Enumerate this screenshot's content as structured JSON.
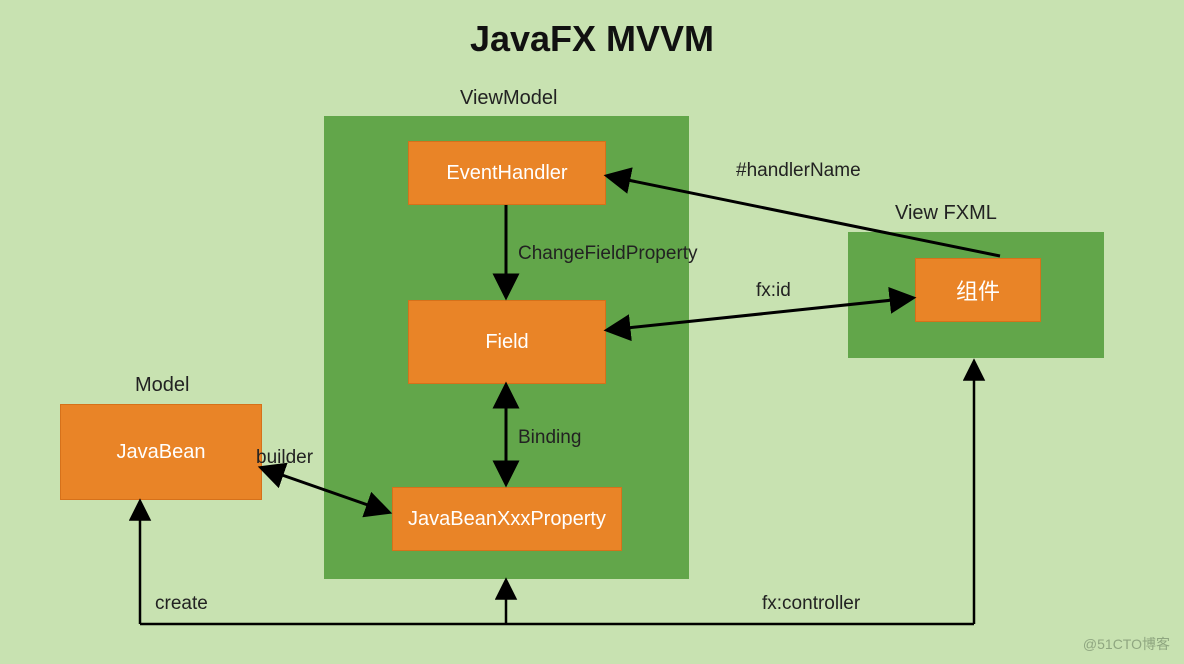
{
  "title": "JavaFX MVVM",
  "containers": {
    "model": {
      "label": "Model"
    },
    "viewmodel": {
      "label": "ViewModel"
    },
    "view": {
      "label": "View FXML"
    }
  },
  "nodes": {
    "javabean": {
      "label": "JavaBean"
    },
    "eventhandler": {
      "label": "EventHandler"
    },
    "field": {
      "label": "Field"
    },
    "javabeanxxxprop": {
      "label": "JavaBeanXxxProperty"
    },
    "component": {
      "label": "组件"
    }
  },
  "edges": {
    "eventhandler_to_field": {
      "label": "ChangeFieldProperty"
    },
    "field_to_javabeanxxxprop": {
      "label": "Binding"
    },
    "javabean_to_javabeanxxxprop": {
      "label": "builder"
    },
    "field_to_component": {
      "label": "fx:id"
    },
    "component_to_eventhandler": {
      "label": "#handlerName"
    },
    "controller_to_javabean": {
      "label": "create"
    },
    "controller_to_view": {
      "label": "fx:controller"
    }
  },
  "watermark": "@51CTO博客"
}
